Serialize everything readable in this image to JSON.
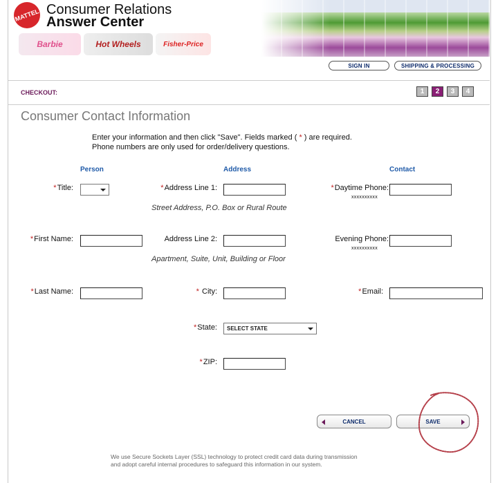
{
  "header": {
    "logo_text": "MATTEL",
    "title_line1": "Consumer Relations",
    "title_line2": "Answer Center",
    "brands": [
      "Barbie",
      "Hot Wheels",
      "Fisher-Price"
    ],
    "sign_in_label": "SIGN IN",
    "shipping_label": "SHIPPING & PROCESSING"
  },
  "checkout": {
    "label": "CHECKOUT:",
    "steps": [
      "1",
      "2",
      "3",
      "4"
    ],
    "active_step": 2
  },
  "page": {
    "title": "Consumer Contact Information",
    "intro_line1_pre": "Enter your information and then click \"Save\".  Fields marked ( ",
    "intro_star": "*",
    "intro_line1_post": " ) are required.",
    "intro_line2": "Phone numbers are only used for order/delivery questions."
  },
  "columns": {
    "person": "Person",
    "address": "Address",
    "contact": "Contact"
  },
  "person": {
    "title_label": "Title:",
    "first_name_label": "First Name:",
    "last_name_label": "Last Name:",
    "title_value": ""
  },
  "address": {
    "line1_label": "Address Line 1:",
    "line1_hint": "Street Address, P.O. Box or Rural Route",
    "line2_label": "Address Line 2:",
    "line2_hint": "Apartment, Suite, Unit, Building or Floor",
    "city_label": "City:",
    "state_label": "State:",
    "state_value": "SELECT STATE",
    "zip_label": "ZIP:"
  },
  "contact": {
    "daytime_label": "Daytime Phone:",
    "daytime_format": "xxxxxxxxxx",
    "evening_label": "Evening Phone:",
    "evening_format": "xxxxxxxxxx",
    "email_label": "Email:"
  },
  "required_mark": "*",
  "buttons": {
    "cancel": "CANCEL",
    "save": "SAVE"
  },
  "footer": {
    "line1": "We use Secure Sockets Layer (SSL) technology to protect credit card data during transmission",
    "line2": "and adopt careful internal procedures to safeguard this information in our system."
  },
  "colors": {
    "accent_purple": "#8a1f75",
    "link_blue": "#1f5aa8",
    "required_red": "#c02020",
    "annotation_red": "#b5404a"
  }
}
